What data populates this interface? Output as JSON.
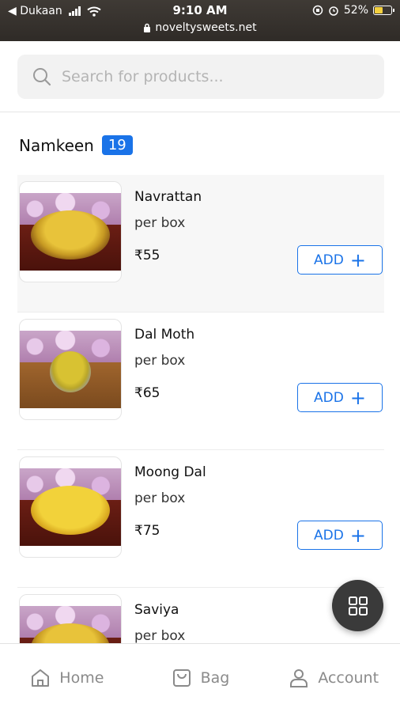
{
  "status_bar": {
    "carrier": "◀ Dukaan",
    "time": "9:10 AM",
    "url": "noveltysweets.net",
    "battery_percent": "52%",
    "battery_level": 0.52
  },
  "search": {
    "placeholder": "Search for products..."
  },
  "category": {
    "title": "Namkeen",
    "count": "19"
  },
  "products": [
    {
      "name": "Navrattan",
      "unit": "per box",
      "price": "₹55",
      "add_label": "ADD",
      "add_icon": "+",
      "image": "navrattan-photo"
    },
    {
      "name": "Dal Moth",
      "unit": "per box",
      "price": "₹65",
      "add_label": "ADD",
      "add_icon": "+",
      "image": "dal-moth-photo"
    },
    {
      "name": "Moong Dal",
      "unit": "per box",
      "price": "₹75",
      "add_label": "ADD",
      "add_icon": "+",
      "image": "moong-dal-photo"
    },
    {
      "name": "Saviya",
      "unit": "per box",
      "image": "saviya-photo"
    }
  ],
  "bottom_nav": {
    "home": "Home",
    "bag": "Bag",
    "account": "Account"
  },
  "colors": {
    "accent": "#1a73e8",
    "fab": "#3a3a3a"
  }
}
